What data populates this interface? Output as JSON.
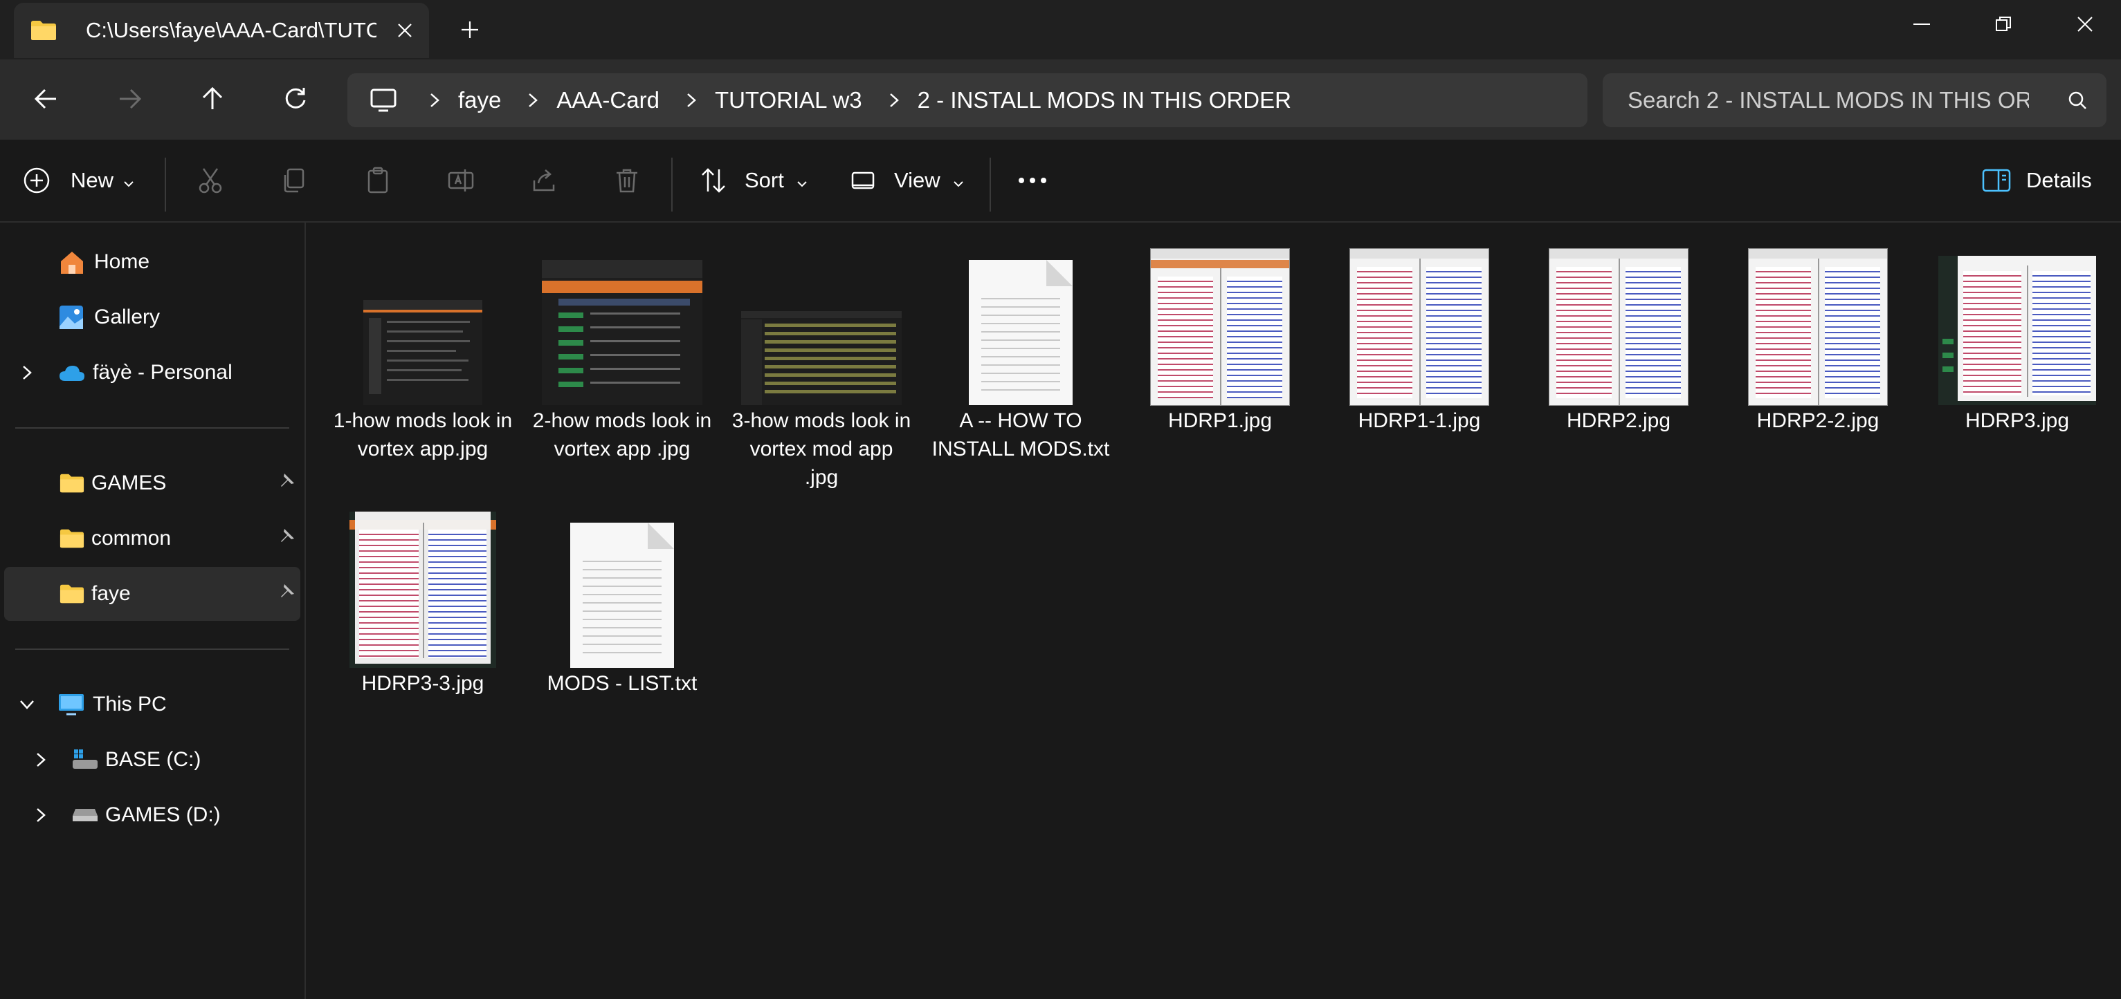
{
  "tab": {
    "title": "C:\\Users\\faye\\AAA-Card\\TUTC"
  },
  "breadcrumb": [
    "faye",
    "AAA-Card",
    "TUTORIAL w3",
    "2 - INSTALL MODS IN THIS ORDER"
  ],
  "search": {
    "placeholder": "Search 2 - INSTALL MODS IN THIS OR"
  },
  "toolbar": {
    "new_label": "New",
    "sort_label": "Sort",
    "view_label": "View",
    "details_label": "Details"
  },
  "sidebar": {
    "top": [
      {
        "label": "Home",
        "icon": "home-icon"
      },
      {
        "label": "Gallery",
        "icon": "gallery-icon"
      },
      {
        "label": "fäyè - Personal",
        "icon": "cloud-icon"
      }
    ],
    "pinned": [
      {
        "label": "GAMES",
        "icon": "folder-icon"
      },
      {
        "label": "common",
        "icon": "folder-icon"
      },
      {
        "label": "faye",
        "icon": "folder-icon"
      }
    ],
    "pc": {
      "label": "This PC",
      "icon": "pc-icon"
    },
    "drives": [
      {
        "label": "BASE (C:)",
        "icon": "drive-icon"
      },
      {
        "label": "GAMES (D:)",
        "icon": "drive-icon"
      }
    ]
  },
  "files": [
    {
      "name": "1-how mods look in vortex app.jpg",
      "type": "dark-shot"
    },
    {
      "name": "2-how mods look in vortex app .jpg",
      "type": "dark-shot"
    },
    {
      "name": "3-how mods look in vortex mod app .jpg",
      "type": "dark-shot"
    },
    {
      "name": "A -- HOW TO INSTALL MODS.txt",
      "type": "text"
    },
    {
      "name": "HDRP1.jpg",
      "type": "light-shot"
    },
    {
      "name": "HDRP1-1.jpg",
      "type": "light-shot"
    },
    {
      "name": "HDRP2.jpg",
      "type": "light-shot"
    },
    {
      "name": "HDRP2-2.jpg",
      "type": "light-shot"
    },
    {
      "name": "HDRP3.jpg",
      "type": "light-shot"
    },
    {
      "name": "HDRP3-3.jpg",
      "type": "light-shot"
    },
    {
      "name": "MODS - LIST.txt",
      "type": "text"
    }
  ],
  "colors": {
    "accent": "#4cc2ff",
    "folder": "#f5c842",
    "bg": "#191919",
    "chrome": "#2c2c2c",
    "vortex_orange": "#d9722b"
  }
}
